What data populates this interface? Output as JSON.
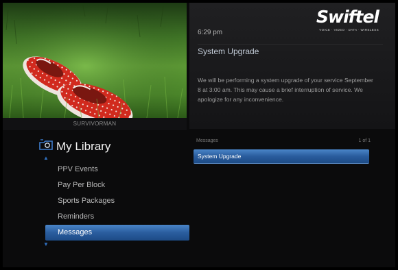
{
  "photo": {
    "caption": "SURVIVORMAN"
  },
  "library": {
    "title": "My Library",
    "icon": "library-folder-icon",
    "items": [
      {
        "label": "PPV Events",
        "selected": false
      },
      {
        "label": "Pay Per Block",
        "selected": false
      },
      {
        "label": "Sports Packages",
        "selected": false
      },
      {
        "label": "Reminders",
        "selected": false
      },
      {
        "label": "Messages",
        "selected": true
      }
    ]
  },
  "header": {
    "time": "6:29 pm",
    "brand": "Swiftel",
    "brand_tagline": "voice · video · data · wireless"
  },
  "detail": {
    "title": "System Upgrade",
    "body": "We will be performing a system upgrade of your service September 8 at 3:00 am. This may cause a brief interruption of service. We apologize for any inconvenience."
  },
  "messages": {
    "header": "Messages",
    "count": "1 of 1",
    "rows": [
      {
        "label": "System Upgrade",
        "selected": true
      }
    ]
  },
  "colors": {
    "highlight": "#2a5d9e",
    "background": "#0b0b0c",
    "shoe_red": "#d12a1e"
  }
}
